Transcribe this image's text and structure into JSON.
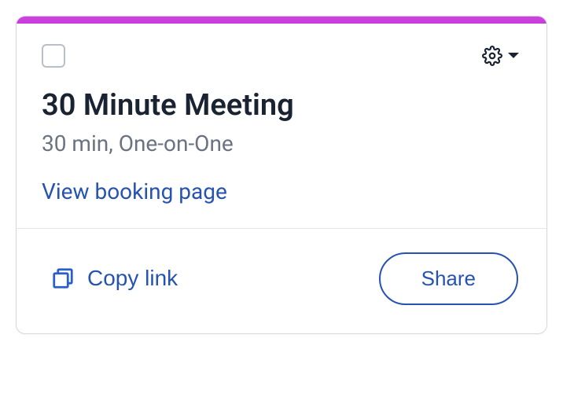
{
  "accent_color": "#c93edc",
  "meeting": {
    "title": "30 Minute Meeting",
    "subtitle": "30 min, One-on-One"
  },
  "links": {
    "view_booking": "View booking page"
  },
  "actions": {
    "copy_link": "Copy link",
    "share": "Share"
  }
}
